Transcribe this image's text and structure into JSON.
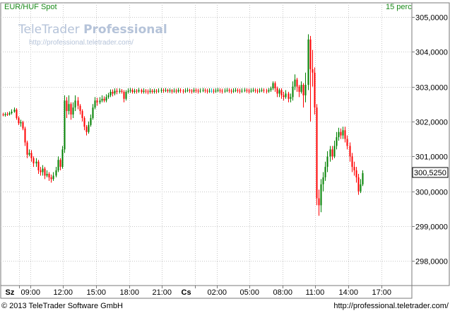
{
  "header": {
    "symbol": "EUR/HUF Spot",
    "interval": "15 perc"
  },
  "watermark": {
    "brand_light": "TeleTrader ",
    "brand_bold": "Professional",
    "url": "http://professional.teletrader.com/"
  },
  "footer": {
    "copyright": "© 2013 TeleTrader Software GmbH",
    "url": "http://professional.teletrader.com/"
  },
  "last_value_label": "300,5250",
  "chart_data": {
    "type": "candlestick",
    "ylim": [
      297.3,
      305.4
    ],
    "y_ticks": [
      298,
      299,
      300,
      301,
      302,
      303,
      304,
      305
    ],
    "y_tick_labels": [
      "298,0000",
      "299,0000",
      "300,0000",
      "301,0000",
      "302,0000",
      "303,0000",
      "304,0000",
      "305,0000"
    ],
    "x_ticks": [
      {
        "label": "Sz",
        "day": true,
        "t": 0
      },
      {
        "label": "09:00",
        "day": false,
        "t": 1
      },
      {
        "label": "12:00",
        "day": false,
        "t": 4
      },
      {
        "label": "15:00",
        "day": false,
        "t": 7
      },
      {
        "label": "18:00",
        "day": false,
        "t": 10
      },
      {
        "label": "21:00",
        "day": false,
        "t": 13
      },
      {
        "label": "Cs",
        "day": true,
        "t": 16
      },
      {
        "label": "02:00",
        "day": false,
        "t": 18
      },
      {
        "label": "05:00",
        "day": false,
        "t": 21
      },
      {
        "label": "08:00",
        "day": false,
        "t": 24
      },
      {
        "label": "11:00",
        "day": false,
        "t": 27
      },
      {
        "label": "14:00",
        "day": false,
        "t": 30
      },
      {
        "label": "17:00",
        "day": false,
        "t": 33
      }
    ],
    "x_range": [
      -1.5,
      35.8
    ],
    "grid": true,
    "colors": {
      "up": "#008000",
      "down": "#ff0000",
      "neutral": "#00c0c0"
    },
    "candles": [
      [
        -1.5,
        302.2,
        302.18,
        302.25,
        302.15
      ],
      [
        -1.3,
        302.18,
        302.21,
        302.26,
        302.14
      ],
      [
        -1.1,
        302.21,
        302.2,
        302.27,
        302.16
      ],
      [
        -0.9,
        302.2,
        302.24,
        302.29,
        302.17
      ],
      [
        -0.7,
        302.24,
        302.28,
        302.35,
        302.2
      ],
      [
        -0.5,
        302.28,
        302.34,
        302.4,
        302.25
      ],
      [
        -0.3,
        302.34,
        302.1,
        302.38,
        302.05
      ],
      [
        -0.1,
        302.1,
        301.95,
        302.15,
        301.9
      ],
      [
        0.1,
        301.95,
        301.98,
        302.05,
        301.85
      ],
      [
        0.3,
        301.98,
        301.8,
        302.02,
        301.75
      ],
      [
        0.5,
        301.8,
        301.4,
        301.85,
        301.3
      ],
      [
        0.7,
        301.4,
        301.05,
        301.45,
        300.95
      ],
      [
        0.9,
        301.05,
        301.1,
        301.2,
        301.0
      ],
      [
        1.1,
        301.1,
        300.95,
        301.18,
        300.85
      ],
      [
        1.3,
        300.95,
        300.8,
        301.0,
        300.7
      ],
      [
        1.5,
        300.8,
        300.85,
        300.95,
        300.7
      ],
      [
        1.7,
        300.85,
        300.6,
        300.9,
        300.5
      ],
      [
        1.9,
        300.6,
        300.55,
        300.7,
        300.45
      ],
      [
        2.1,
        300.55,
        300.65,
        300.75,
        300.45
      ],
      [
        2.3,
        300.65,
        300.45,
        300.7,
        300.35
      ],
      [
        2.5,
        300.45,
        300.5,
        300.6,
        300.4
      ],
      [
        2.7,
        300.5,
        300.4,
        300.55,
        300.3
      ],
      [
        2.9,
        300.4,
        300.35,
        300.48,
        300.25
      ],
      [
        3.1,
        300.35,
        300.45,
        300.55,
        300.3
      ],
      [
        3.3,
        300.45,
        300.6,
        300.7,
        300.4
      ],
      [
        3.5,
        300.6,
        300.9,
        301.0,
        300.55
      ],
      [
        3.7,
        300.9,
        300.7,
        300.95,
        300.6
      ],
      [
        3.9,
        300.7,
        301.2,
        301.3,
        300.65
      ],
      [
        4.1,
        301.2,
        302.6,
        302.75,
        301.1
      ],
      [
        4.3,
        302.6,
        302.3,
        302.7,
        302.1
      ],
      [
        4.5,
        302.3,
        302.5,
        302.75,
        302.2
      ],
      [
        4.7,
        302.5,
        302.2,
        302.55,
        302.05
      ],
      [
        4.9,
        302.2,
        302.4,
        302.55,
        302.1
      ],
      [
        5.1,
        302.4,
        302.6,
        302.75,
        302.3
      ],
      [
        5.3,
        302.6,
        302.45,
        302.7,
        302.35
      ],
      [
        5.5,
        302.45,
        302.3,
        302.5,
        302.2
      ],
      [
        5.7,
        302.3,
        302.1,
        302.35,
        302.0
      ],
      [
        5.9,
        302.1,
        301.85,
        302.15,
        301.75
      ],
      [
        6.1,
        301.85,
        301.7,
        301.9,
        301.6
      ],
      [
        6.3,
        301.7,
        301.9,
        302.0,
        301.65
      ],
      [
        6.5,
        301.9,
        302.1,
        302.2,
        301.85
      ],
      [
        6.7,
        302.1,
        302.4,
        302.5,
        302.05
      ],
      [
        6.9,
        302.4,
        302.6,
        302.7,
        302.35
      ],
      [
        7.1,
        302.6,
        302.55,
        302.68,
        302.45
      ],
      [
        7.3,
        302.55,
        302.6,
        302.7,
        302.5
      ],
      [
        7.5,
        302.6,
        302.65,
        302.75,
        302.55
      ],
      [
        7.7,
        302.65,
        302.6,
        302.72,
        302.55
      ],
      [
        7.9,
        302.6,
        302.7,
        302.78,
        302.55
      ],
      [
        8.1,
        302.7,
        302.75,
        302.82,
        302.65
      ],
      [
        8.3,
        302.75,
        302.85,
        302.92,
        302.7
      ],
      [
        8.5,
        302.85,
        302.8,
        302.92,
        302.72
      ],
      [
        8.7,
        302.8,
        302.88,
        302.95,
        302.75
      ],
      [
        8.9,
        302.88,
        302.85,
        302.95,
        302.78
      ],
      [
        9.1,
        302.85,
        302.88,
        302.95,
        302.8
      ],
      [
        9.3,
        302.88,
        302.85,
        302.93,
        302.8
      ],
      [
        9.5,
        302.85,
        302.65,
        302.9,
        302.55
      ],
      [
        9.7,
        302.65,
        302.85,
        302.9,
        302.6
      ],
      [
        9.9,
        302.85,
        302.88,
        302.95,
        302.8
      ],
      [
        10.1,
        302.88,
        302.9,
        302.96,
        302.82
      ],
      [
        10.3,
        302.9,
        302.85,
        302.95,
        302.8
      ],
      [
        10.5,
        302.85,
        302.88,
        302.94,
        302.8
      ],
      [
        10.7,
        302.88,
        302.86,
        302.93,
        302.8
      ],
      [
        10.9,
        302.86,
        302.9,
        302.96,
        302.82
      ],
      [
        11.1,
        302.9,
        302.85,
        302.94,
        302.8
      ],
      [
        11.3,
        302.85,
        302.88,
        302.95,
        302.8
      ],
      [
        11.5,
        302.88,
        302.86,
        302.93,
        302.8
      ],
      [
        11.7,
        302.86,
        302.85,
        302.92,
        302.78
      ],
      [
        11.9,
        302.85,
        302.88,
        302.95,
        302.8
      ],
      [
        12.1,
        302.88,
        302.85,
        302.93,
        302.8
      ],
      [
        12.3,
        302.85,
        302.88,
        302.94,
        302.8
      ],
      [
        12.5,
        302.88,
        302.86,
        302.93,
        302.8
      ],
      [
        12.7,
        302.86,
        302.88,
        302.95,
        302.82
      ],
      [
        12.9,
        302.88,
        302.9,
        302.96,
        302.82
      ],
      [
        13.1,
        302.9,
        302.88,
        302.95,
        302.82
      ],
      [
        13.3,
        302.88,
        302.9,
        302.96,
        302.84
      ],
      [
        13.5,
        302.9,
        302.87,
        302.94,
        302.82
      ],
      [
        13.7,
        302.87,
        302.89,
        302.95,
        302.82
      ],
      [
        13.9,
        302.89,
        302.86,
        302.93,
        302.8
      ],
      [
        14.1,
        302.86,
        302.88,
        302.95,
        302.82
      ],
      [
        14.3,
        302.88,
        302.86,
        302.94,
        302.8
      ],
      [
        14.5,
        302.86,
        302.9,
        302.96,
        302.82
      ],
      [
        14.7,
        302.9,
        302.88,
        302.95,
        302.82
      ],
      [
        14.9,
        302.88,
        302.86,
        302.93,
        302.8
      ],
      [
        15.1,
        302.86,
        302.88,
        302.95,
        302.82
      ],
      [
        15.3,
        302.88,
        302.9,
        302.96,
        302.84
      ],
      [
        15.5,
        302.9,
        302.88,
        302.94,
        302.82
      ],
      [
        15.7,
        302.88,
        302.86,
        302.93,
        302.8
      ],
      [
        15.9,
        302.86,
        302.9,
        302.96,
        302.82
      ],
      [
        16.1,
        302.9,
        302.88,
        302.95,
        302.82
      ],
      [
        16.3,
        302.88,
        302.86,
        302.94,
        302.8
      ],
      [
        16.5,
        302.86,
        302.88,
        302.95,
        302.82
      ],
      [
        16.7,
        302.88,
        302.9,
        302.96,
        302.84
      ],
      [
        16.9,
        302.9,
        302.88,
        302.95,
        302.82
      ],
      [
        17.1,
        302.88,
        302.86,
        302.94,
        302.8
      ],
      [
        17.3,
        302.86,
        302.88,
        302.95,
        302.82
      ],
      [
        17.5,
        302.88,
        302.88,
        302.95,
        302.82
      ],
      [
        17.7,
        302.88,
        302.86,
        302.94,
        302.8
      ],
      [
        17.9,
        302.86,
        302.88,
        302.95,
        302.82
      ],
      [
        18.1,
        302.88,
        302.9,
        302.96,
        302.84
      ],
      [
        18.3,
        302.9,
        302.88,
        302.95,
        302.82
      ],
      [
        18.5,
        302.88,
        302.86,
        302.94,
        302.8
      ],
      [
        18.7,
        302.86,
        302.88,
        302.95,
        302.82
      ],
      [
        18.9,
        302.88,
        302.9,
        302.96,
        302.84
      ],
      [
        19.1,
        302.9,
        302.88,
        302.95,
        302.82
      ],
      [
        19.3,
        302.88,
        302.86,
        302.94,
        302.8
      ],
      [
        19.5,
        302.86,
        302.88,
        302.95,
        302.82
      ],
      [
        19.7,
        302.88,
        302.9,
        302.96,
        302.84
      ],
      [
        19.9,
        302.9,
        302.88,
        302.95,
        302.82
      ],
      [
        20.1,
        302.88,
        302.86,
        302.94,
        302.8
      ],
      [
        20.3,
        302.86,
        302.88,
        302.95,
        302.82
      ],
      [
        20.5,
        302.88,
        302.9,
        302.96,
        302.84
      ],
      [
        20.7,
        302.9,
        302.88,
        302.95,
        302.82
      ],
      [
        20.9,
        302.88,
        302.86,
        302.94,
        302.8
      ],
      [
        21.1,
        302.86,
        302.88,
        302.95,
        302.82
      ],
      [
        21.3,
        302.88,
        302.9,
        302.96,
        302.84
      ],
      [
        21.5,
        302.9,
        302.88,
        302.95,
        302.82
      ],
      [
        21.7,
        302.88,
        302.86,
        302.94,
        302.8
      ],
      [
        21.9,
        302.86,
        302.88,
        302.95,
        302.82
      ],
      [
        22.1,
        302.88,
        302.9,
        302.96,
        302.84
      ],
      [
        22.3,
        302.9,
        302.88,
        302.95,
        302.82
      ],
      [
        22.5,
        302.88,
        302.86,
        302.94,
        302.8
      ],
      [
        22.7,
        302.86,
        302.9,
        302.96,
        302.82
      ],
      [
        22.9,
        302.9,
        302.95,
        303.0,
        302.85
      ],
      [
        23.1,
        302.95,
        303.1,
        303.15,
        302.9
      ],
      [
        23.3,
        303.1,
        302.95,
        303.15,
        302.85
      ],
      [
        23.5,
        302.95,
        302.8,
        303.0,
        302.7
      ],
      [
        23.7,
        302.8,
        302.9,
        302.95,
        302.7
      ],
      [
        23.9,
        302.9,
        302.75,
        302.95,
        302.65
      ],
      [
        24.1,
        302.75,
        302.7,
        302.85,
        302.6
      ],
      [
        24.3,
        302.7,
        302.8,
        302.9,
        302.65
      ],
      [
        24.5,
        302.8,
        302.65,
        302.85,
        302.55
      ],
      [
        24.7,
        302.65,
        302.7,
        302.8,
        302.55
      ],
      [
        24.9,
        302.7,
        303.0,
        303.15,
        302.6
      ],
      [
        25.1,
        303.0,
        303.2,
        303.35,
        302.9
      ],
      [
        25.3,
        303.2,
        303.0,
        303.25,
        302.85
      ],
      [
        25.5,
        303.0,
        302.85,
        303.05,
        302.7
      ],
      [
        25.7,
        302.85,
        303.05,
        303.15,
        302.8
      ],
      [
        25.9,
        303.05,
        302.75,
        303.1,
        302.4
      ],
      [
        26.1,
        302.75,
        303.05,
        303.4,
        302.55
      ],
      [
        26.3,
        303.05,
        304.35,
        304.5,
        302.9
      ],
      [
        26.5,
        304.35,
        303.5,
        304.45,
        302.0
      ],
      [
        26.7,
        303.5,
        303.4,
        304.05,
        303.0
      ],
      [
        26.9,
        303.4,
        302.4,
        303.55,
        302.2
      ],
      [
        27.1,
        302.4,
        299.8,
        302.5,
        299.6
      ],
      [
        27.3,
        299.8,
        299.6,
        300.05,
        299.3
      ],
      [
        27.5,
        299.6,
        300.2,
        300.35,
        299.4
      ],
      [
        27.7,
        300.2,
        300.4,
        300.55,
        300.0
      ],
      [
        27.9,
        300.4,
        300.7,
        300.85,
        300.3
      ],
      [
        28.1,
        300.7,
        301.0,
        301.15,
        300.55
      ],
      [
        28.3,
        301.0,
        301.2,
        301.3,
        300.85
      ],
      [
        28.5,
        301.2,
        301.0,
        301.3,
        300.9
      ],
      [
        28.7,
        301.0,
        301.3,
        301.45,
        300.95
      ],
      [
        28.9,
        301.3,
        301.55,
        301.7,
        301.2
      ],
      [
        29.1,
        301.55,
        301.7,
        301.82,
        301.45
      ],
      [
        29.3,
        301.7,
        301.6,
        301.8,
        301.5
      ],
      [
        29.5,
        301.6,
        301.75,
        301.85,
        301.5
      ],
      [
        29.7,
        301.75,
        301.5,
        301.85,
        301.4
      ],
      [
        29.9,
        301.5,
        301.3,
        301.6,
        301.2
      ],
      [
        30.1,
        301.3,
        301.0,
        301.4,
        300.85
      ],
      [
        30.3,
        301.0,
        300.7,
        301.1,
        300.55
      ],
      [
        30.5,
        300.7,
        300.6,
        300.85,
        300.45
      ],
      [
        30.7,
        300.6,
        300.4,
        300.7,
        300.25
      ],
      [
        30.9,
        300.4,
        300.0,
        300.5,
        299.9
      ],
      [
        31.1,
        300.0,
        300.2,
        300.35,
        299.95
      ],
      [
        31.3,
        300.2,
        300.52,
        300.6,
        300.15
      ]
    ]
  }
}
